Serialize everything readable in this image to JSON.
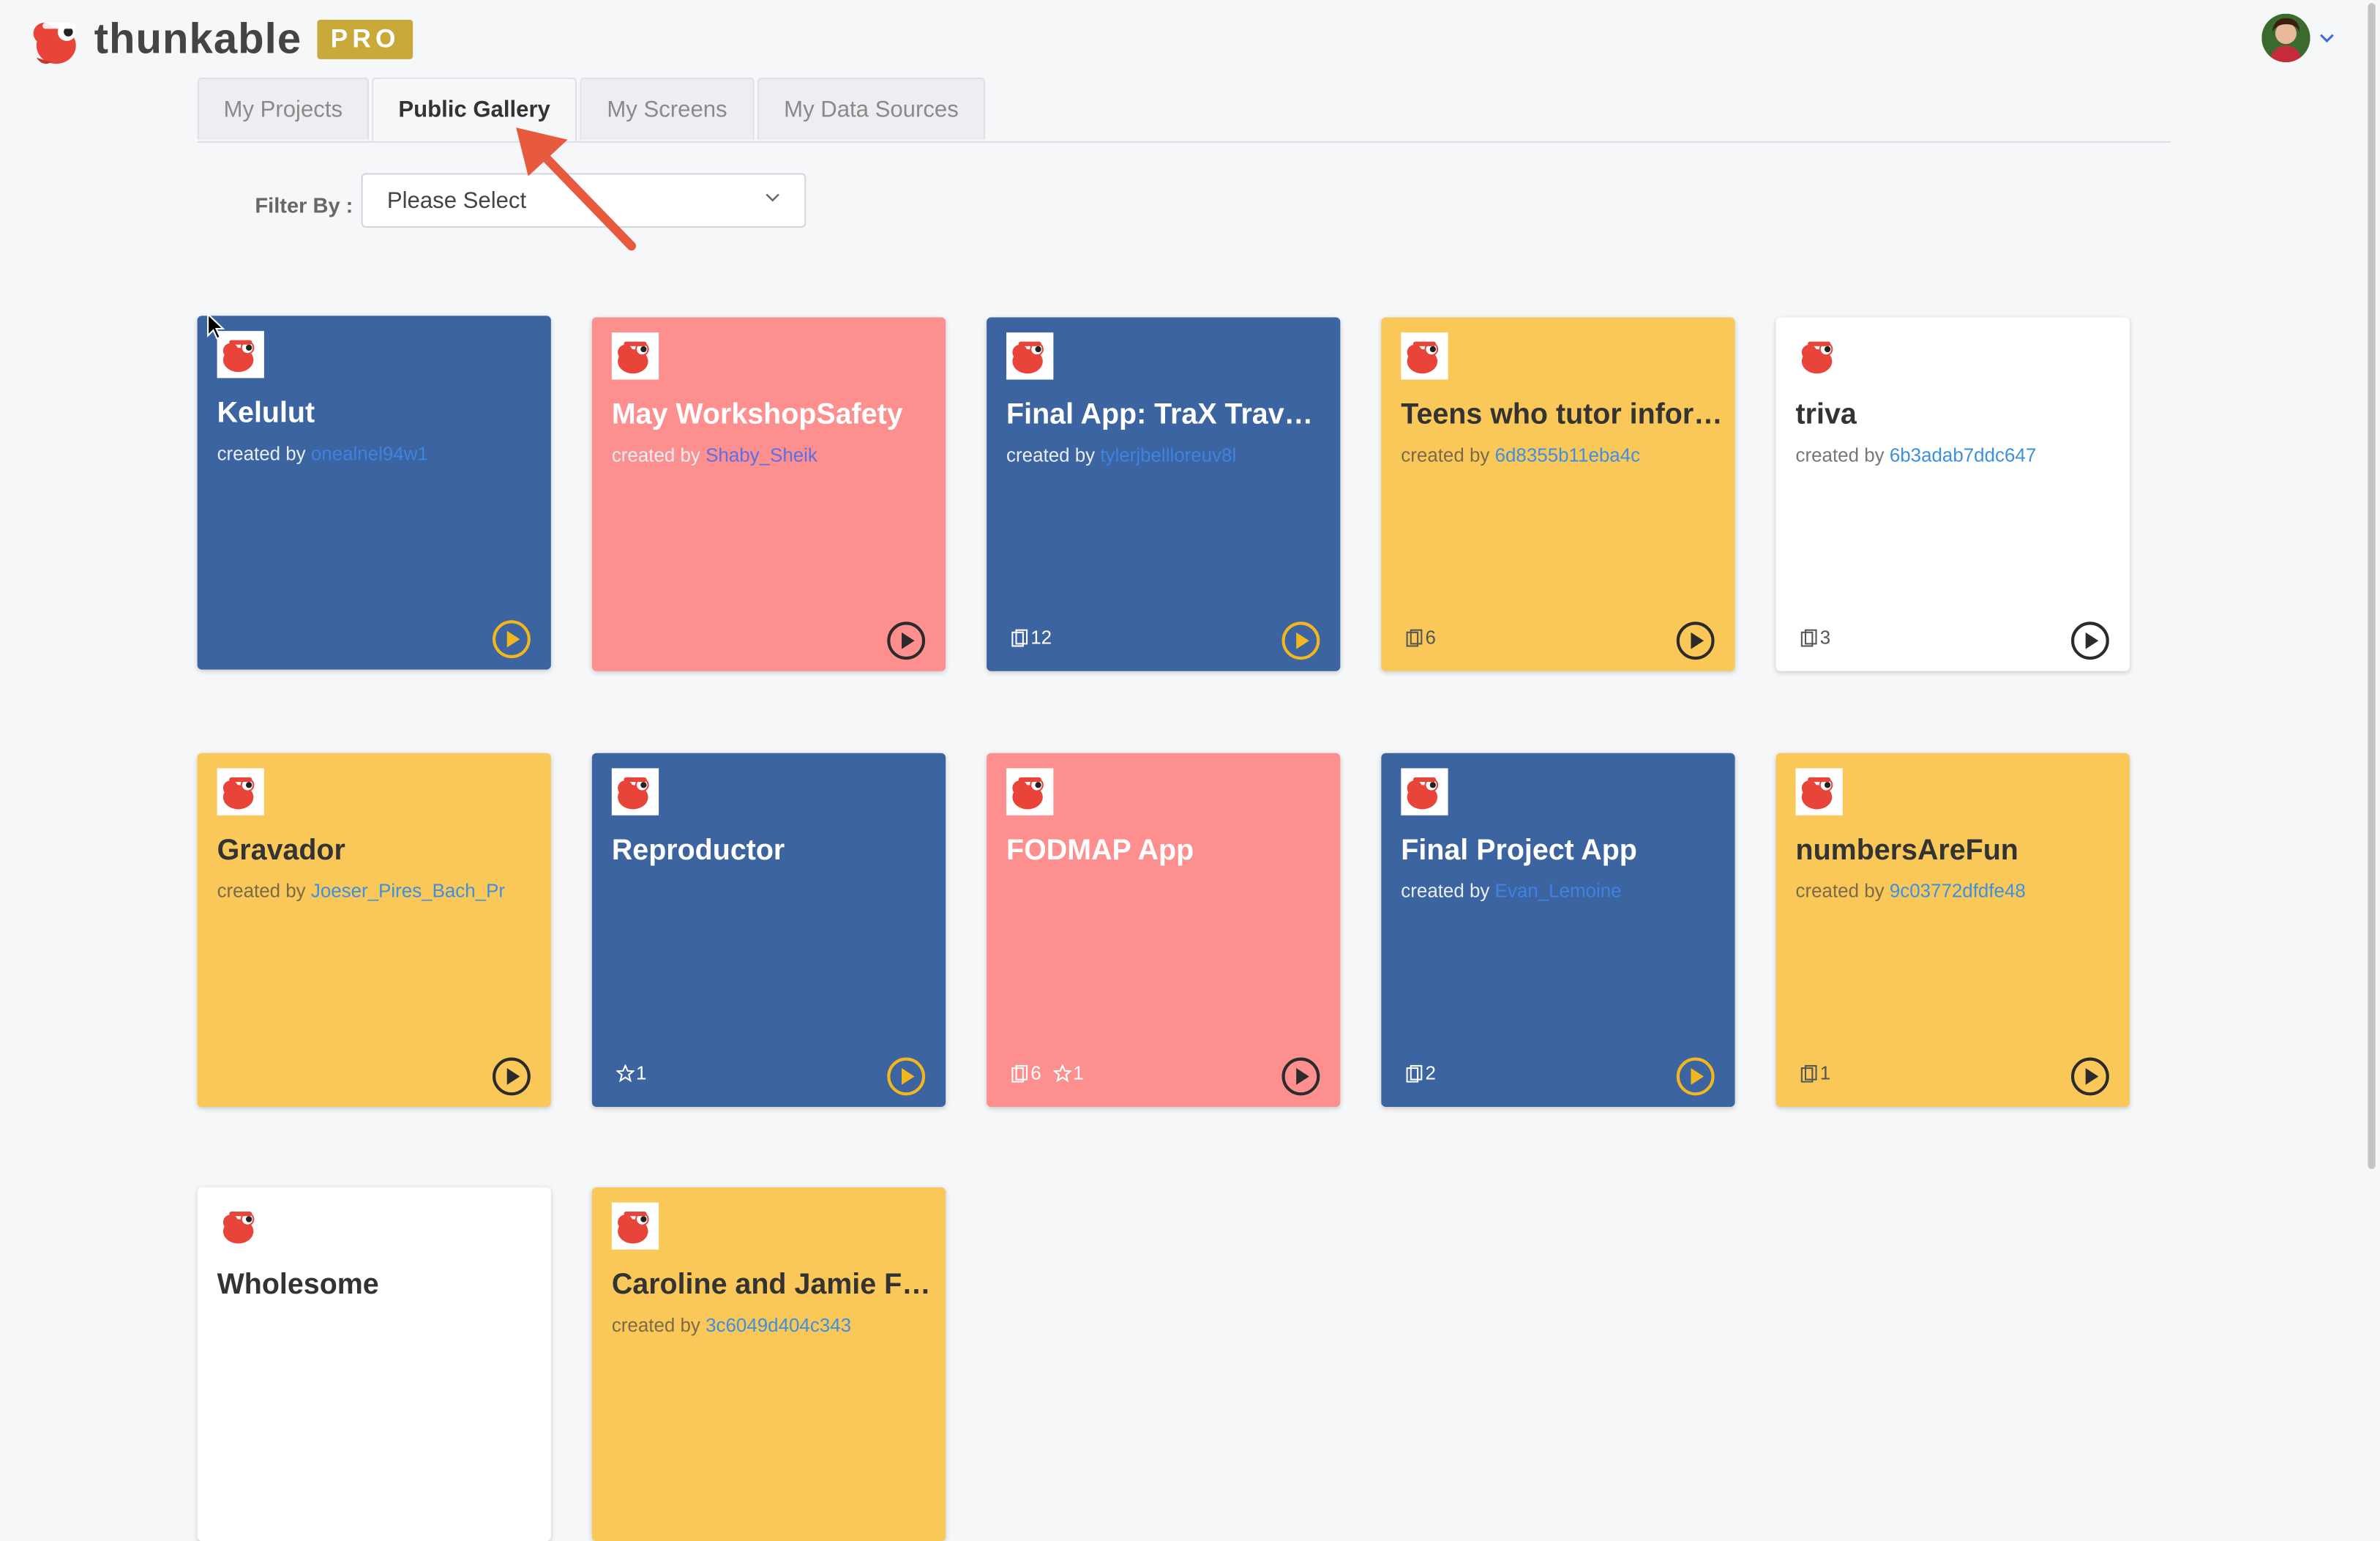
{
  "brand": {
    "name": "thunkable",
    "badge": "PRO"
  },
  "tabs": [
    "My Projects",
    "Public Gallery",
    "My Screens",
    "My Data Sources"
  ],
  "filter": {
    "label": "Filter By :",
    "value": "Please Select"
  },
  "created_by_prefix": "created by",
  "colors": {
    "blue": "#3b64a0",
    "pink": "#fd8f8f",
    "yellow": "#fac858",
    "white": "#ffffff",
    "pro_badge": "#c9a93a",
    "play_ring": "#f2b61e"
  },
  "cards": [
    {
      "title": "Kelulut",
      "creator": "onealnel94w1",
      "screens": "",
      "stars": ""
    },
    {
      "title": "May WorkshopSafety",
      "creator": "Shaby_Sheik",
      "screens": "",
      "stars": ""
    },
    {
      "title": "Final App: TraX Travel Tracker",
      "creator": "tylerjbellloreuv8l",
      "screens": "12",
      "stars": ""
    },
    {
      "title": "Teens who tutor information",
      "creator": "6d8355b11eba4c",
      "screens": "6",
      "stars": ""
    },
    {
      "title": "triva",
      "creator": "6b3adab7ddc647",
      "screens": "3",
      "stars": ""
    },
    {
      "title": "Gravador",
      "creator": "Joeser_Pires_Bach_Pr",
      "screens": "",
      "stars": ""
    },
    {
      "title": "Reproductor",
      "creator": "",
      "screens": "",
      "stars": "1"
    },
    {
      "title": "FODMAP App",
      "creator": "",
      "screens": "6",
      "stars": "1"
    },
    {
      "title": "Final Project App",
      "creator": "Evan_Lemoine",
      "screens": "2",
      "stars": ""
    },
    {
      "title": "numbersAreFun",
      "creator": "9c03772dfdfe48",
      "screens": "1",
      "stars": ""
    },
    {
      "title": "Wholesome",
      "creator": "",
      "screens": "",
      "stars": ""
    },
    {
      "title": "Caroline and Jamie Final App",
      "creator": "3c6049d404c343",
      "screens": "",
      "stars": ""
    }
  ]
}
